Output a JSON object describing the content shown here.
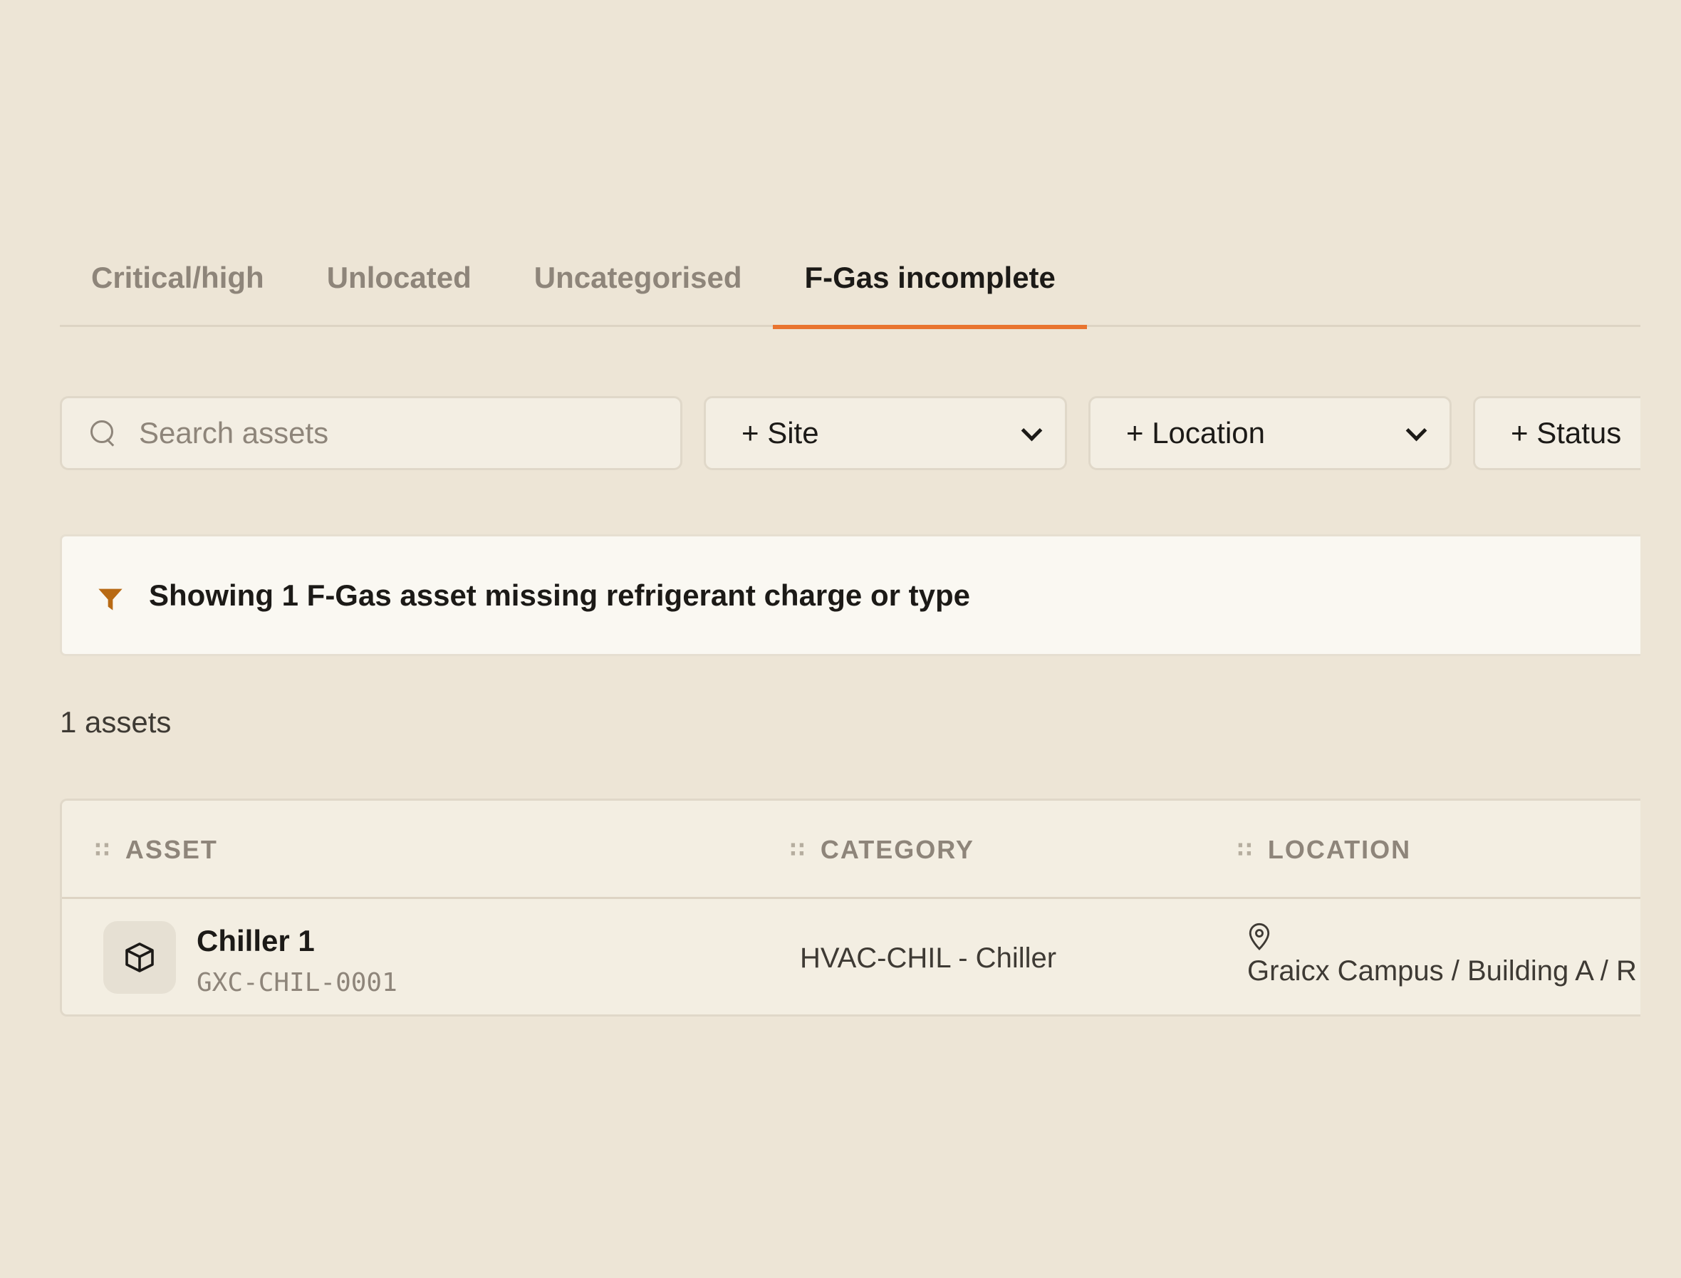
{
  "tabs": [
    {
      "label": "Critical/high",
      "active": false
    },
    {
      "label": "Unlocated",
      "active": false
    },
    {
      "label": "Uncategorised",
      "active": false
    },
    {
      "label": "F-Gas incomplete",
      "active": true
    }
  ],
  "filters": {
    "search_placeholder": "Search assets",
    "site_label": "+ Site",
    "location_label": "+ Location",
    "status_label": "+ Status"
  },
  "banner": {
    "icon": "funnel-icon",
    "text": "Showing 1 F-Gas asset missing refrigerant charge or type"
  },
  "count_text": "1 assets",
  "table": {
    "columns": [
      {
        "label": "ASSET"
      },
      {
        "label": "CATEGORY"
      },
      {
        "label": "LOCATION"
      }
    ],
    "rows": [
      {
        "icon": "cube-icon",
        "name": "Chiller 1",
        "code": "GXC-CHIL-0001",
        "category": "HVAC-CHIL - Chiller",
        "location_icon": "map-pin-icon",
        "location": "Graicx Campus / Building A / R"
      }
    ]
  },
  "colors": {
    "background": "#ede5d6",
    "accent": "#e9742f",
    "funnel": "#b86a14",
    "muted_text": "#8e857a"
  }
}
